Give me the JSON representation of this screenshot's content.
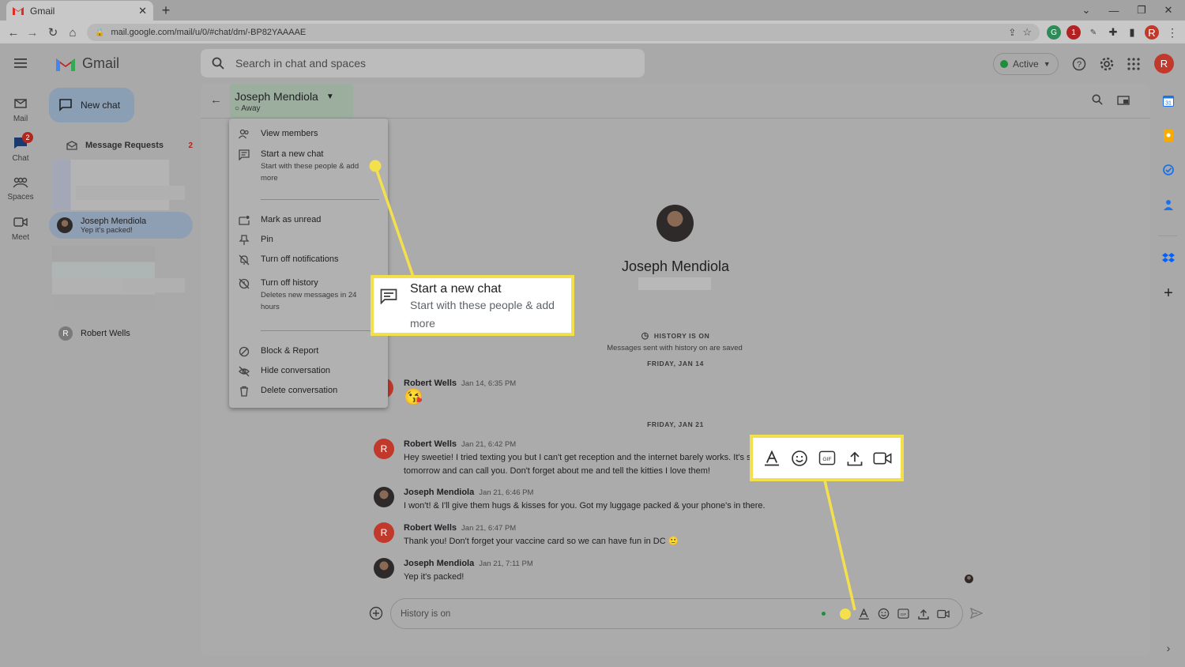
{
  "browser": {
    "tab_title": "Gmail",
    "url": "mail.google.com/mail/u/0/#chat/dm/-BP82YAAAAE",
    "profile_initial": "R",
    "ext_badge": "1"
  },
  "app": {
    "name": "Gmail",
    "search_placeholder": "Search in chat and spaces",
    "status": "Active",
    "account_initial": "R"
  },
  "rail": {
    "mail": "Mail",
    "chat": "Chat",
    "chat_badge": "2",
    "spaces": "Spaces",
    "meet": "Meet"
  },
  "sidebar": {
    "new_chat": "New chat",
    "message_requests": "Message Requests",
    "message_requests_count": "2",
    "active_dm": {
      "name": "Joseph Mendiola",
      "snippet": "Yep it's packed!"
    },
    "other_dm": {
      "name": "Robert Wells",
      "initial": "R"
    }
  },
  "chat": {
    "title": "Joseph Mendiola",
    "status": "Away",
    "profile_name": "Joseph Mendiola",
    "history_label": "HISTORY IS ON",
    "history_sub": "Messages sent with history on are saved",
    "date1": "FRIDAY, JAN 14",
    "date2": "FRIDAY, JAN 21",
    "messages": [
      {
        "author": "Robert Wells",
        "time": "Jan 14, 6:35 PM",
        "text": "😘",
        "initial": "R"
      },
      {
        "author": "Robert Wells",
        "time": "Jan 21, 6:42 PM",
        "text": "Hey sweetie! I tried texting you but I can't get reception and the internet barely works. It's sn",
        "text2": "tomorrow and can call you. Don't forget about me and tell the kitties I love them!",
        "initial": "R"
      },
      {
        "author": "Joseph Mendiola",
        "time": "Jan 21, 6:46 PM",
        "text": "I won't! & I'll give them hugs & kisses for you. Got my luggage packed & your phone's in there."
      },
      {
        "author": "Robert Wells",
        "time": "Jan 21, 6:47 PM",
        "text": "Thank you! Don't forget your vaccine card so we can have fun in DC 🙂",
        "initial": "R"
      },
      {
        "author": "Joseph Mendiola",
        "time": "Jan 21, 7:11 PM",
        "text": "Yep it's packed!"
      }
    ],
    "composer_placeholder": "History is on"
  },
  "menu": {
    "items": [
      {
        "label": "View members"
      },
      {
        "label": "Start a new chat",
        "sub": "Start with these people & add",
        "sub2": "more"
      },
      {
        "label": "Mark as unread"
      },
      {
        "label": "Pin"
      },
      {
        "label": "Turn off notifications"
      },
      {
        "label": "Turn off history",
        "sub": "Deletes new messages in 24",
        "sub2": "hours"
      },
      {
        "label": "Block & Report"
      },
      {
        "label": "Hide conversation"
      },
      {
        "label": "Delete conversation"
      }
    ]
  },
  "callout": {
    "title": "Start a new chat",
    "sub": "Start with these people & add",
    "sub2": "more"
  },
  "colors": {
    "highlight": "#f4e04d",
    "badge": "#b3261e",
    "active_green": "#1e8e3e",
    "avatar_red": "#c0392b"
  }
}
